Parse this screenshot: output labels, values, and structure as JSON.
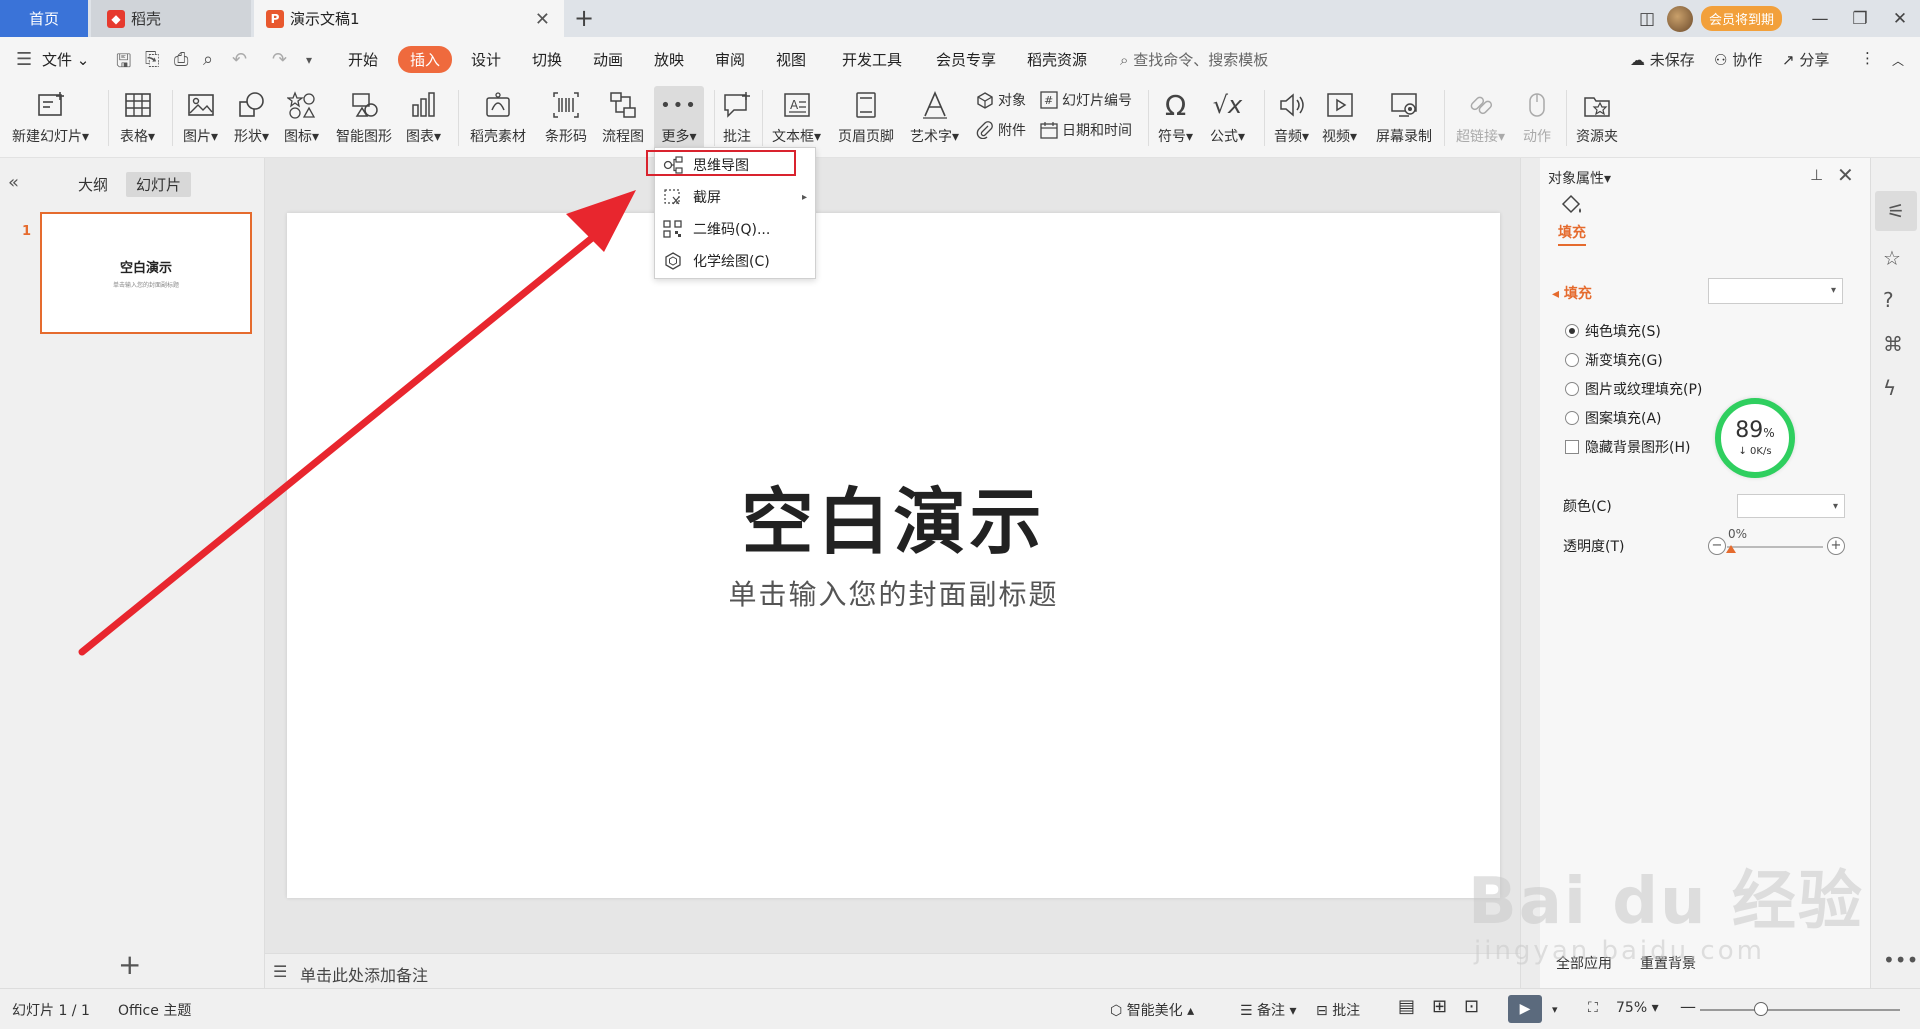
{
  "tabs": {
    "home": "首页",
    "daoke": "稻壳",
    "doc": "演示文稿1",
    "vip": "会员将到期"
  },
  "menu": {
    "file": "文件",
    "items": [
      "开始",
      "插入",
      "设计",
      "切换",
      "动画",
      "放映",
      "审阅",
      "视图",
      "开发工具",
      "会员专享",
      "稻壳资源"
    ],
    "search": "查找命令、搜索模板",
    "unsaved": "未保存",
    "collab": "协作",
    "share": "分享"
  },
  "ribbon": {
    "new_slide": "新建幻灯片",
    "table": "表格",
    "picture": "图片",
    "shape": "形状",
    "icon": "图标",
    "smartart": "智能图形",
    "chart": "图表",
    "daoke_material": "稻壳素材",
    "barcode": "条形码",
    "flowchart": "流程图",
    "more": "更多",
    "comment": "批注",
    "textbox": "文本框",
    "header_footer": "页眉页脚",
    "wordart": "艺术字",
    "object": "对象",
    "slide_number": "幻灯片编号",
    "attachment": "附件",
    "datetime": "日期和时间",
    "symbol": "符号",
    "formula": "公式",
    "audio": "音频",
    "video": "视频",
    "screen_record": "屏幕录制",
    "hyperlink": "超链接",
    "action": "动作",
    "resource": "资源夹"
  },
  "dropdown": {
    "items": [
      "思维导图",
      "截屏",
      "二维码(Q)...",
      "化学绘图(C)"
    ]
  },
  "leftpanel": {
    "outline": "大纲",
    "slides": "幻灯片",
    "slide_number": "1",
    "thumb_title": "空白演示",
    "thumb_sub": "单击输入您的封面副标题"
  },
  "slide": {
    "title": "空白演示",
    "subtitle": "单击输入您的封面副标题"
  },
  "notes": {
    "placeholder": "单击此处添加备注"
  },
  "props": {
    "title": "对象属性",
    "fill_tab": "填充",
    "fill_section": "填充",
    "options": [
      "纯色填充(S)",
      "渐变填充(G)",
      "图片或纹理填充(P)",
      "图案填充(A)"
    ],
    "hide_bg": "隐藏背景图形(H)",
    "color": "颜色(C)",
    "opacity": "透明度(T)",
    "opacity_value": "0%",
    "apply_all": "全部应用",
    "reset_bg": "重置背景"
  },
  "speed": {
    "percent": "89",
    "percent_sign": "%",
    "rate": "0K/s"
  },
  "status": {
    "slide_count": "幻灯片 1 / 1",
    "theme": "Office 主题",
    "beautify": "智能美化",
    "notes": "备注",
    "comment": "批注",
    "zoom": "75%"
  },
  "watermark": {
    "brand": "Bai du 经验",
    "url": "jingyan.baidu.com"
  },
  "colors": {
    "accent": "#ef6a3d",
    "home_tab": "#3a73d8",
    "highlight_box": "#d9232e",
    "arrow": "#e8262e",
    "speed_ring": "#2fcf5f"
  }
}
